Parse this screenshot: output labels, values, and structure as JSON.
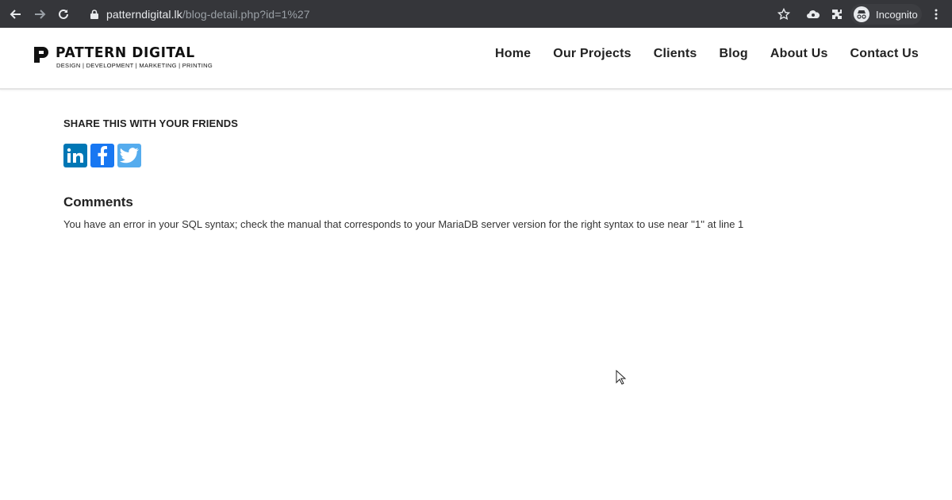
{
  "browser": {
    "url_host": "patterndigital.lk",
    "url_path": "/blog-detail.php?id=1%27",
    "profile_label": "Incognito"
  },
  "site": {
    "logo_name": "PATTERN DIGITAL",
    "logo_tagline": "DESIGN | DEVELOPMENT | MARKETING | PRINTING",
    "nav": [
      "Home",
      "Our Projects",
      "Clients",
      "Blog",
      "About Us",
      "Contact Us"
    ]
  },
  "content": {
    "share_title": "SHARE THIS WITH YOUR FRIENDS",
    "share_icons": [
      "linkedin-icon",
      "facebook-icon",
      "twitter-icon"
    ],
    "comments_title": "Comments",
    "error_message": "You have an error in your SQL syntax; check the manual that corresponds to your MariaDB server version for the right syntax to use near ''1'' at line 1"
  },
  "colors": {
    "chrome_bg": "#35363a",
    "linkedin": "#0077b5",
    "facebook": "#1877f2",
    "twitter": "#55acee"
  }
}
